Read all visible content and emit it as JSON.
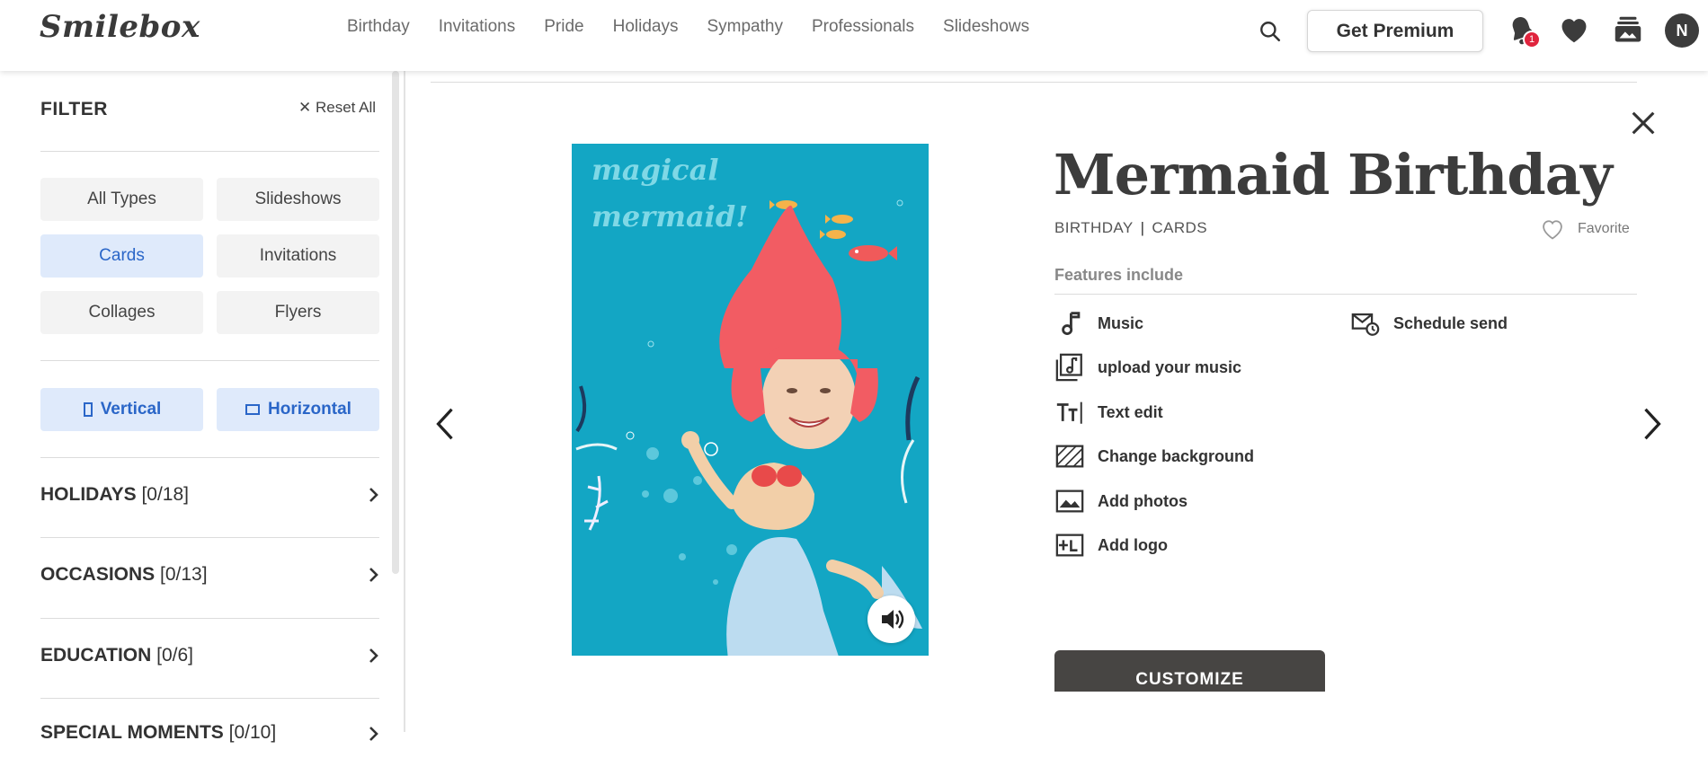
{
  "brand": {
    "logo": "Smilebox"
  },
  "nav": {
    "items": [
      "Birthday",
      "Invitations",
      "Pride",
      "Holidays",
      "Sympathy",
      "Professionals",
      "Slideshows"
    ]
  },
  "header": {
    "premium_label": "Get Premium",
    "notification_count": "1",
    "avatar_initial": "N"
  },
  "filter": {
    "title": "FILTER",
    "reset_label": "Reset All",
    "types": [
      {
        "label": "All Types"
      },
      {
        "label": "Slideshows"
      },
      {
        "label": "Cards",
        "selected": true
      },
      {
        "label": "Invitations"
      },
      {
        "label": "Collages"
      },
      {
        "label": "Flyers"
      }
    ],
    "orientation": [
      {
        "label": "Vertical",
        "selected": true
      },
      {
        "label": "Horizontal",
        "selected": true
      }
    ],
    "sections": [
      {
        "name": "HOLIDAYS",
        "count": "[0/18]"
      },
      {
        "name": "OCCASIONS",
        "count": "[0/13]"
      },
      {
        "name": "EDUCATION",
        "count": "[0/6]"
      },
      {
        "name": "SPECIAL MOMENTS",
        "count": "[0/10]"
      }
    ]
  },
  "card": {
    "title": "Mermaid Birthday",
    "category": "BIRTHDAY",
    "type": "CARDS",
    "favorite_label": "Favorite",
    "preview_text_line1": "magical",
    "preview_text_line2": "mermaid!",
    "features_heading": "Features include",
    "features": [
      {
        "label": "Music",
        "icon": "music-note-icon"
      },
      {
        "label": "Schedule send",
        "icon": "schedule-send-icon"
      },
      {
        "label": "upload your music",
        "icon": "upload-music-icon"
      },
      {
        "label": "Text edit",
        "icon": "text-edit-icon"
      },
      {
        "label": "Change background",
        "icon": "background-icon"
      },
      {
        "label": "Add photos",
        "icon": "photo-icon"
      },
      {
        "label": "Add logo",
        "icon": "add-logo-icon"
      }
    ],
    "customize_label": "CUSTOMIZE"
  },
  "colors": {
    "accent_blue": "#2a66c8",
    "selected_chip_bg": "#dfeafb",
    "preview_bg": "#13a6c4",
    "badge_red": "#e0243d",
    "customize_bg": "#474543"
  }
}
